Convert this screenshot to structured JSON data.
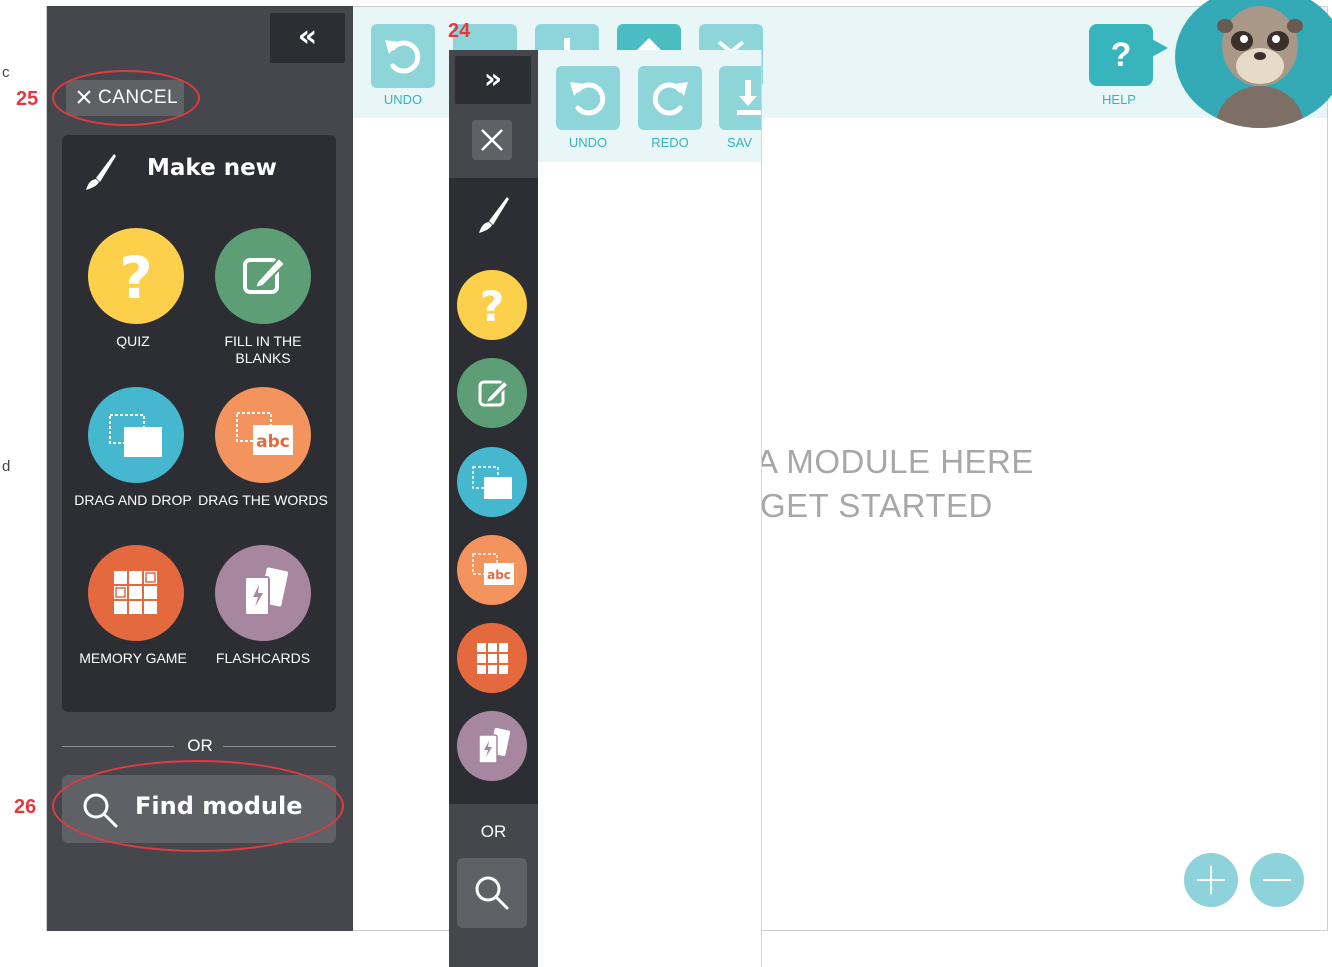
{
  "stray": {
    "top_char": "c",
    "mid_char": "d"
  },
  "toolbar": {
    "undo_label": "UNDO",
    "help_label": "HELP",
    "help_glyph": "?"
  },
  "canvas": {
    "hint_line1": "A MODULE HERE",
    "hint_line2": "GET STARTED"
  },
  "sidebar": {
    "collapse_glyph": "«",
    "cancel_label": "CANCEL",
    "make_new_title": "Make new",
    "modules": [
      {
        "id": "quiz",
        "label": "QUIZ",
        "icon": "question-icon",
        "color": "#fdd04b"
      },
      {
        "id": "fill",
        "label": "FILL IN THE BLANKS",
        "icon": "edit-pencil-icon",
        "color": "#5e9e76"
      },
      {
        "id": "drag",
        "label": "DRAG AND DROP",
        "icon": "drag-drop-icon",
        "color": "#45b8d0"
      },
      {
        "id": "words",
        "label": "DRAG THE WORDS",
        "icon": "abc-icon",
        "color": "#f3935e"
      },
      {
        "id": "memory",
        "label": "MEMORY GAME",
        "icon": "grid-star-icon",
        "color": "#e5693f"
      },
      {
        "id": "flash",
        "label": "FLASHCARDS",
        "icon": "cards-icon",
        "color": "#a7879f"
      }
    ],
    "or_label": "OR",
    "find_label": "Find module"
  },
  "overlay": {
    "expand_glyph": "»",
    "undo_label": "UNDO",
    "redo_label": "REDO",
    "save_label": "SAV",
    "or_label": "OR"
  },
  "annotations": {
    "n24": "24",
    "n25": "25",
    "n26": "26"
  },
  "colors": {
    "accent": "#38b4bc",
    "sidebar_bg": "#45474c",
    "panel_bg": "#2c2e33",
    "annotation": "#e23a41"
  }
}
